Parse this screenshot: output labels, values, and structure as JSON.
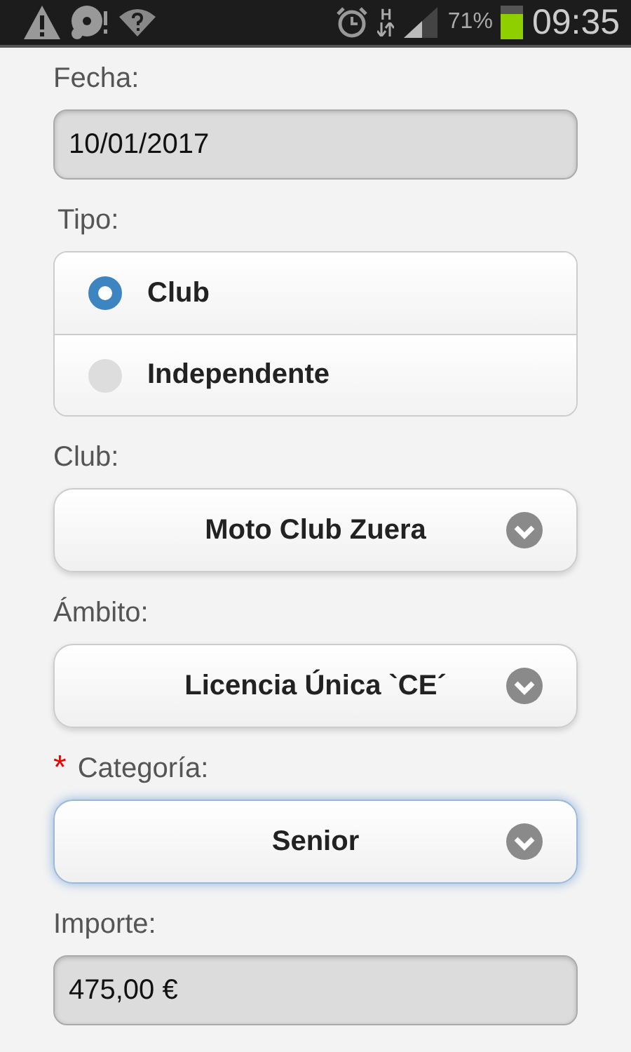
{
  "status_bar": {
    "network_type": "H",
    "battery_percent": "71%",
    "time": "09:35"
  },
  "fields": [
    {
      "kind": "text_input",
      "label": "Fecha:",
      "value": "10/01/2017",
      "disabled": true
    },
    {
      "kind": "radio_group",
      "label": "Tipo:",
      "options": [
        {
          "label": "Club",
          "selected": true
        },
        {
          "label": "Independente",
          "selected": false
        }
      ]
    },
    {
      "kind": "select",
      "label": "Club:",
      "value": "Moto Club Zuera",
      "focused": false
    },
    {
      "kind": "select",
      "label": "Ámbito:",
      "value": "Licencia Única `CE´",
      "focused": false
    },
    {
      "kind": "select",
      "label": "Categoría:",
      "required_mark": "*",
      "value": "Senior",
      "focused": true
    },
    {
      "kind": "text_input",
      "label": "Importe:",
      "value": "475,00 €",
      "disabled": true
    }
  ]
}
